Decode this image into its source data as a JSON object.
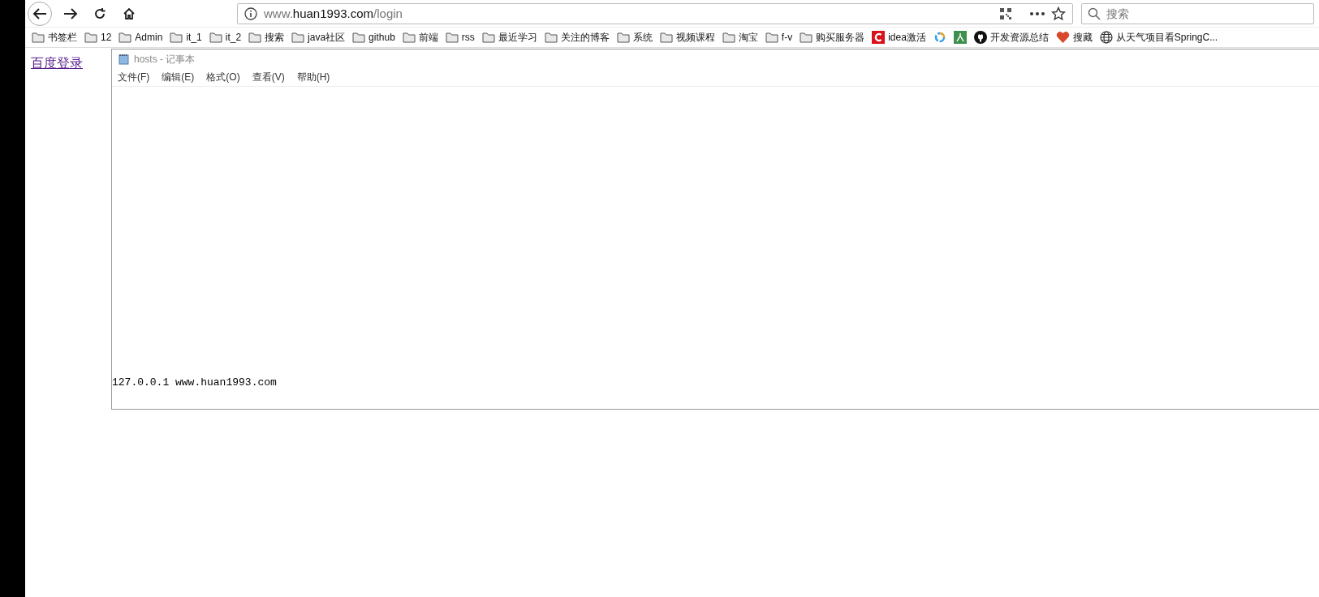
{
  "toolbar": {
    "url_prefix": "www.",
    "url_host": "huan1993.com",
    "url_path": "/login",
    "search_placeholder": "搜索"
  },
  "bookmarks": [
    {
      "kind": "folder",
      "label": "书签栏"
    },
    {
      "kind": "folder",
      "label": "12"
    },
    {
      "kind": "folder",
      "label": "Admin"
    },
    {
      "kind": "folder",
      "label": "it_1"
    },
    {
      "kind": "folder",
      "label": "it_2"
    },
    {
      "kind": "folder",
      "label": "搜索"
    },
    {
      "kind": "folder",
      "label": "java社区"
    },
    {
      "kind": "folder",
      "label": "github"
    },
    {
      "kind": "folder",
      "label": "前端"
    },
    {
      "kind": "folder",
      "label": "rss"
    },
    {
      "kind": "folder",
      "label": "最近学习"
    },
    {
      "kind": "folder",
      "label": "关注的博客"
    },
    {
      "kind": "folder",
      "label": "系统"
    },
    {
      "kind": "folder",
      "label": "视频课程"
    },
    {
      "kind": "folder",
      "label": "淘宝"
    },
    {
      "kind": "folder",
      "label": "f-v"
    },
    {
      "kind": "folder",
      "label": "购买服务器"
    },
    {
      "kind": "letter-c",
      "label": "idea激活"
    },
    {
      "kind": "ring"
    },
    {
      "kind": "person"
    },
    {
      "kind": "github",
      "label": "开发资源总结"
    },
    {
      "kind": "heart",
      "label": "搜藏"
    },
    {
      "kind": "globe",
      "label": "从天气项目看SpringC..."
    }
  ],
  "page": {
    "link": "百度登录"
  },
  "notepad": {
    "title": "hosts - 记事本",
    "menu": [
      "文件(F)",
      "编辑(E)",
      "格式(O)",
      "查看(V)",
      "帮助(H)"
    ],
    "lines": [
      "127.0.0.1 www.huan1993.com"
    ]
  }
}
